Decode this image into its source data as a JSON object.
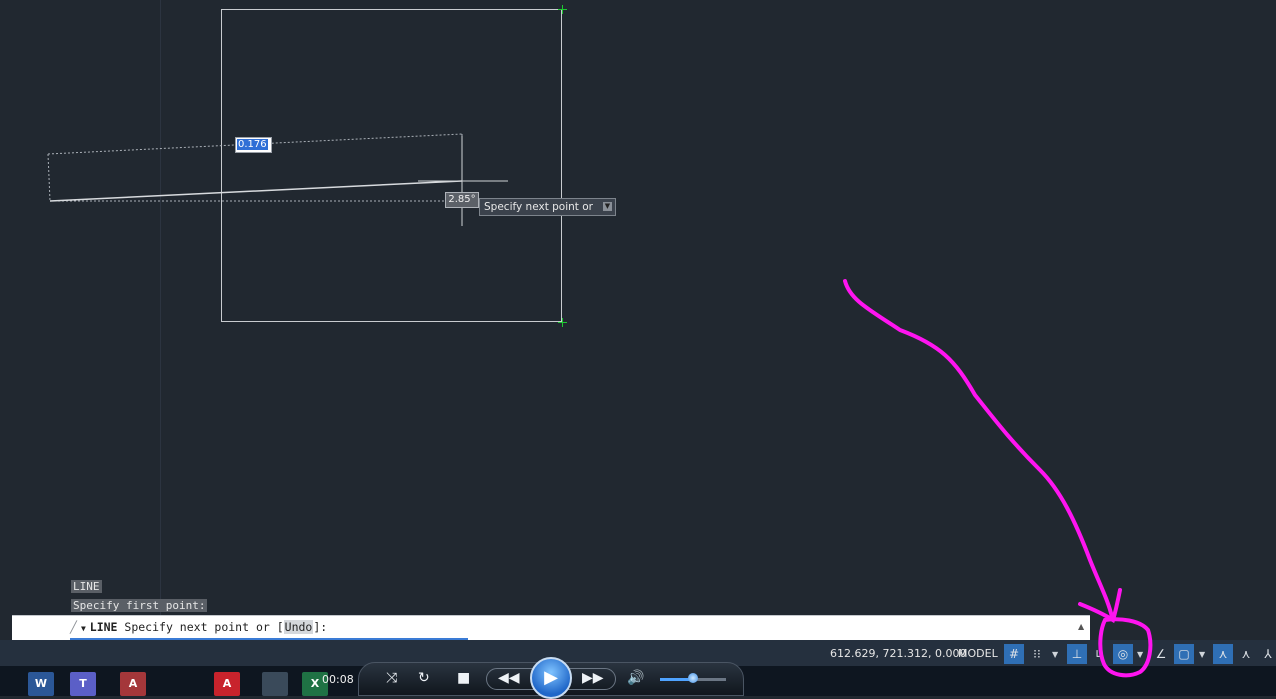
{
  "viewport": {
    "dynamic_input_value": "0.176",
    "angle_value": "2.85°",
    "tooltip_text": "Specify next point or"
  },
  "command_history": [
    "LINE",
    "Specify first point:"
  ],
  "command_line": {
    "command": "LINE",
    "prompt_before": "Specify next point or [",
    "option": "Undo",
    "prompt_after": "]:"
  },
  "status_bar": {
    "coordinates": "612.629, 721.312, 0.000",
    "space": "MODEL",
    "toggles": [
      {
        "name": "grid-display",
        "on": true
      },
      {
        "name": "snap-mode",
        "on": false
      },
      {
        "name": "infer-constraints",
        "on": true
      },
      {
        "name": "dynamic-input",
        "on": false
      },
      {
        "name": "polar-tracking",
        "on": true
      },
      {
        "name": "isometric-drafting",
        "on": false
      },
      {
        "name": "object-snap-tracking",
        "on": true
      },
      {
        "name": "annotation-scale",
        "on": true
      }
    ]
  },
  "media_player": {
    "elapsed": "00:08"
  },
  "taskbar": {
    "apps": [
      "W",
      "T",
      "A",
      "A",
      "X"
    ]
  },
  "colors": {
    "canvas": "#212830",
    "annotation": "#ff14f0",
    "grip": "#1ec832",
    "toggle_on": "#2f6fb5"
  }
}
